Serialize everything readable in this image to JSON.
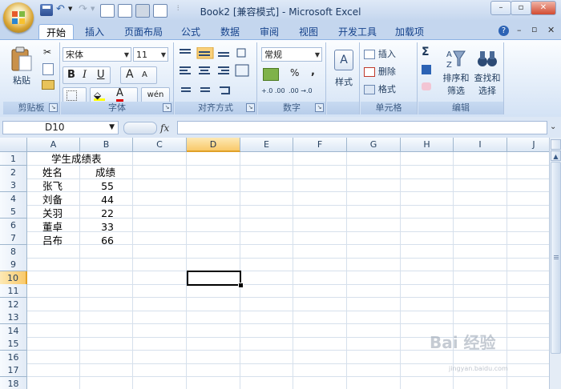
{
  "window": {
    "title": "Book2  [兼容模式] - Microsoft Excel",
    "minimize": "–",
    "restore": "▫",
    "close": "✕"
  },
  "ribbon_tabs": [
    "开始",
    "插入",
    "页面布局",
    "公式",
    "数据",
    "审阅",
    "视图",
    "开发工具",
    "加载项"
  ],
  "ribbon_controls": {
    "window_minimize": "–",
    "window_restore": "▫",
    "window_close": "✕",
    "help": "?"
  },
  "groups": {
    "clipboard": {
      "label": "剪贴板",
      "paste": "粘贴"
    },
    "font": {
      "label": "字体",
      "font_name": "宋体",
      "font_size": "11",
      "bold": "B",
      "italic": "I",
      "underline": "U",
      "grow": "A",
      "shrink": "A",
      "font_color": "A",
      "phonetic": "wén"
    },
    "alignment": {
      "label": "对齐方式"
    },
    "number": {
      "label": "数字",
      "format": "常规",
      "percent": "%",
      "comma": ",",
      "inc_decimal": "+.0 .00",
      "dec_decimal": ".00 →.0"
    },
    "styles": {
      "label": "样式"
    },
    "cells": {
      "label": "单元格",
      "insert": "插入",
      "delete": "删除",
      "format": "格式"
    },
    "editing": {
      "label": "编辑",
      "sort_filter_1": "排序和",
      "sort_filter_2": "筛选",
      "find_select_1": "查找和",
      "find_select_2": "选择",
      "sum": "Σ"
    }
  },
  "formula_bar": {
    "name_box": "D10",
    "fx": "fx",
    "formula": ""
  },
  "columns": [
    "A",
    "B",
    "C",
    "D",
    "E",
    "F",
    "G",
    "H",
    "I",
    "J"
  ],
  "selected_column": "D",
  "rows": [
    "1",
    "2",
    "3",
    "4",
    "5",
    "6",
    "7",
    "8",
    "9",
    "10",
    "11",
    "12",
    "13",
    "14",
    "15",
    "16",
    "17",
    "18"
  ],
  "selected_row": "10",
  "sheet": {
    "A1": "学生成绩表",
    "A2": "姓名",
    "B2": "成绩",
    "A3": "张飞",
    "B3": "55",
    "A4": "刘备",
    "B4": "44",
    "A5": "关羽",
    "B5": "22",
    "A6": "董卓",
    "B6": "33",
    "A7": "吕布",
    "B7": "66"
  },
  "watermark": {
    "text": "Bai  经验",
    "sub": "jingyan.baidu.com"
  },
  "colors": {
    "accent": "#15428b",
    "selection": "#f9c96a"
  }
}
